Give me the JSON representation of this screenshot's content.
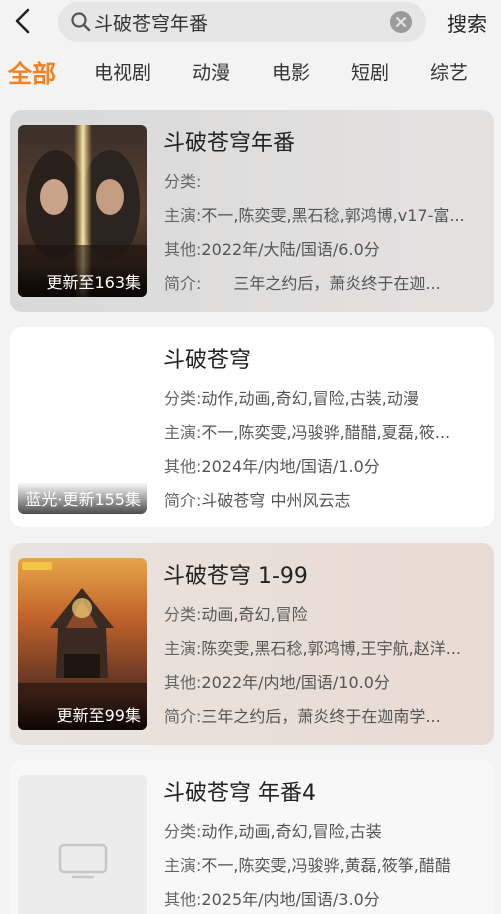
{
  "search": {
    "query": "斗破苍穹年番",
    "action_label": "搜索"
  },
  "tabs": [
    {
      "label": "全部",
      "active": true
    },
    {
      "label": "电视剧"
    },
    {
      "label": "动漫"
    },
    {
      "label": "电影"
    },
    {
      "label": "短剧"
    },
    {
      "label": "综艺"
    }
  ],
  "labels": {
    "category": "分类:",
    "cast": "主演:",
    "other": "其他:",
    "intro": "简介:"
  },
  "results": [
    {
      "title": "斗破苍穹年番",
      "badge": "更新至163集",
      "category": "",
      "cast": "不一,陈奕雯,黑石稔,郭鸿博,v17-富...",
      "other": "2022年/大陆/国语/6.0分",
      "intro": "　　三年之约后，萧炎终于在迦...",
      "bg": "#dcdcdc"
    },
    {
      "title": "斗破苍穹",
      "badge": "蓝光·更新155集",
      "category": "动作,动画,奇幻,冒险,古装,动漫",
      "cast": "不一,陈奕雯,冯骏骅,醋醋,夏磊,筱...",
      "other": "2024年/内地/国语/1.0分",
      "intro": "斗破苍穹 中州风云志",
      "bg": "#ffffff"
    },
    {
      "title": "斗破苍穹 1-99",
      "badge": "更新至99集",
      "category": "动画,奇幻,冒险",
      "cast": "陈奕雯,黑石稔,郭鸿博,王宇航,赵洋...",
      "other": "2022年/内地/国语/10.0分",
      "intro": "三年之约后，萧炎终于在迦南学...",
      "bg": "#e8dfd8"
    },
    {
      "title": "斗破苍穹 年番4",
      "badge": "",
      "category": "动作,动画,奇幻,冒险,古装",
      "cast": "不一,陈奕雯,冯骏骅,黄磊,筱筝,醋醋",
      "other": "2025年/内地/国语/3.0分",
      "intro": "",
      "bg": "#f7f7f7"
    }
  ],
  "colors": {
    "accent": "#f5801f"
  },
  "icons": {
    "back": "chevron-left-icon",
    "search": "search-icon",
    "clear": "clear-icon",
    "placeholder": "tv-icon"
  }
}
